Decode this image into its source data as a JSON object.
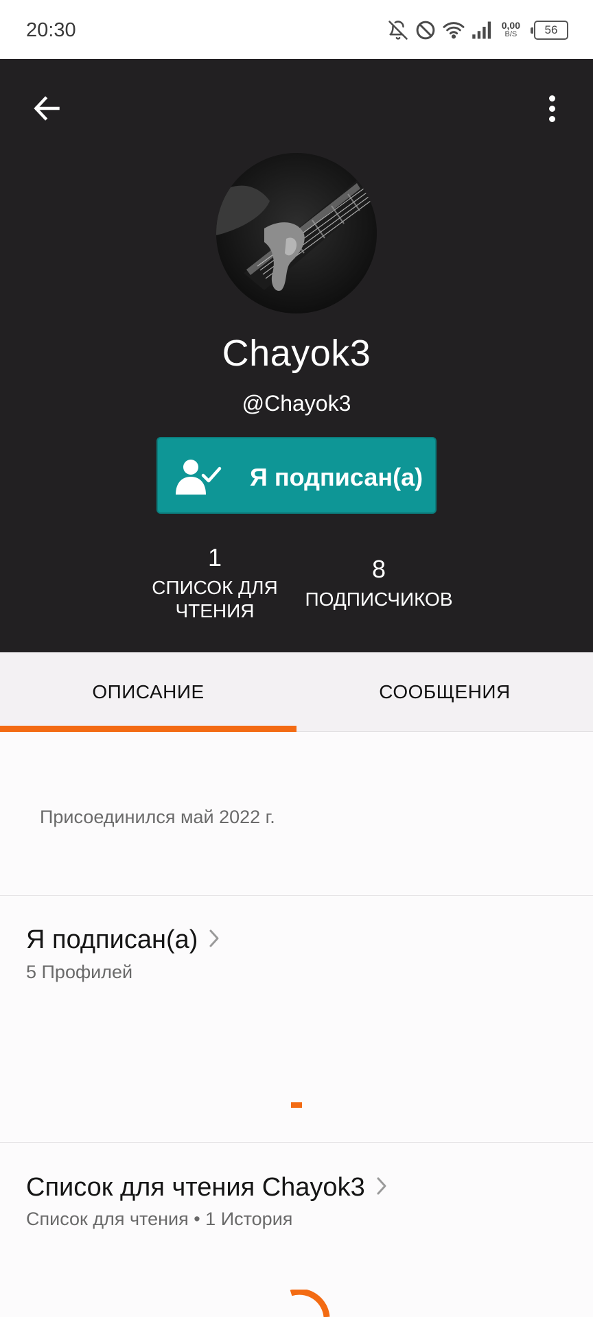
{
  "status_bar": {
    "time": "20:30",
    "icons": [
      "bell-off-icon",
      "do-not-disturb-icon",
      "wifi-icon",
      "cellular-signal-icon"
    ],
    "net_speed_value": "0,00",
    "net_speed_unit": "B/S",
    "battery": "56"
  },
  "header": {
    "back_icon": "arrow-left-icon",
    "menu_icon": "more-vertical-icon",
    "display_name": "Chayok3",
    "username": "@Chayok3",
    "follow_button": {
      "label": "Я подписан(а)",
      "icon": "user-check-icon",
      "color": "#0e9696"
    },
    "stats": {
      "reading_lists": {
        "value": "1",
        "label_line1": "СПИСОК ДЛЯ",
        "label_line2": "ЧТЕНИЯ"
      },
      "followers": {
        "value": "8",
        "label": "ПОДПИСЧИКОВ"
      }
    },
    "background_color": "#222022"
  },
  "tabs": [
    {
      "label": "ОПИСАНИЕ",
      "active": true
    },
    {
      "label": "СООБЩЕНИЯ",
      "active": false
    }
  ],
  "accent_color": "#f36b13",
  "about": {
    "joined": "Присоединился май 2022 г."
  },
  "following": {
    "title": "Я подписан(а)",
    "subtitle": "5 Профилей"
  },
  "reading_list": {
    "title": "Список для чтения Chayok3",
    "subtitle": "Список для чтения • 1 История"
  }
}
